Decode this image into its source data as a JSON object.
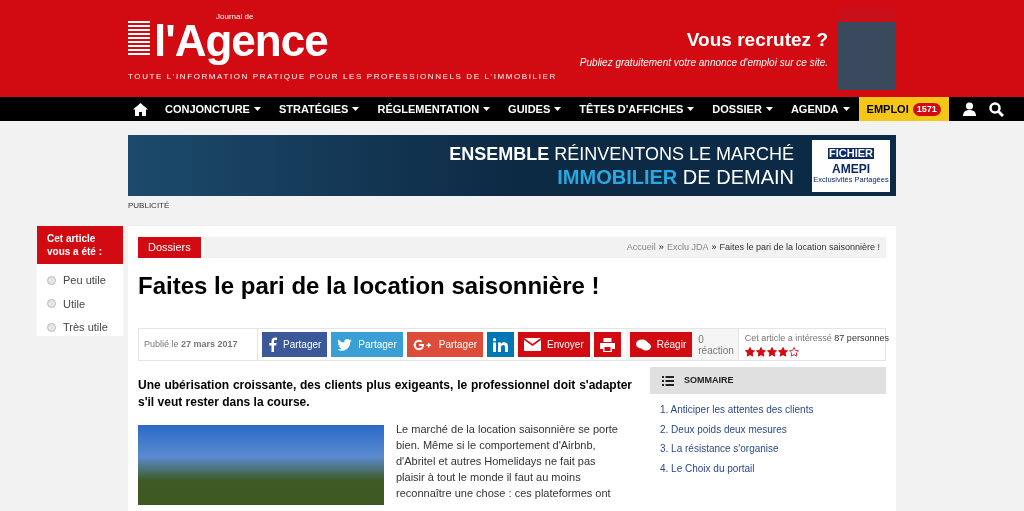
{
  "header": {
    "logo": {
      "small": "Journal de",
      "name": "l'Agence"
    },
    "tagline": "TOUTE L'INFORMATION PRATIQUE POUR LES PROFESSIONNELS DE L'IMMOBILIER",
    "promo": {
      "title": "Vous recrutez ?",
      "subtitle": "Publiez gratuitement votre annonce d'emploi sur ce site."
    }
  },
  "nav": {
    "items": [
      {
        "label": "CONJONCTURE"
      },
      {
        "label": "STRATÉGIES"
      },
      {
        "label": "RÉGLEMENTATION"
      },
      {
        "label": "GUIDES"
      },
      {
        "label": "TÊTES D'AFFICHES"
      },
      {
        "label": "DOSSIER"
      },
      {
        "label": "AGENDA"
      }
    ],
    "emploi": {
      "label": "EMPLOI",
      "count": "1571"
    }
  },
  "banner": {
    "line_1_bold": "ENSEMBLE",
    "line_1": "RÉINVENTONS LE MARCHÉ",
    "line_2_accent": "IMMOBILIER",
    "line_2": "DE DEMAIN",
    "logo_top": "FICHIER",
    "logo_name": "AMEPI",
    "logo_sub": "Exclusivités Partagées"
  },
  "ad_label": "PUBLICITÉ",
  "rating_box": {
    "title": "Cet article vous a été :",
    "options": [
      {
        "label": "Peu utile",
        "selected": false
      },
      {
        "label": "Utile",
        "selected": false
      },
      {
        "label": "Très utile",
        "selected": false
      }
    ]
  },
  "article": {
    "category": "Dossiers",
    "breadcrumb_separator": "»",
    "breadcrumb": [
      {
        "label": "Accueil",
        "current": false
      },
      {
        "label": "Exclu JDA",
        "current": false
      },
      {
        "label": "Faites le pari de la location saisonnière !",
        "current": true
      }
    ],
    "title": "Faites le pari de la location saisonnière !",
    "published": "Publié le **27 mars 2017**",
    "share": [
      {
        "kind": "facebook",
        "label": "Partager"
      },
      {
        "kind": "twitter",
        "label": "Partager"
      },
      {
        "kind": "gplus",
        "label": "Partager"
      },
      {
        "kind": "linkedin"
      },
      {
        "kind": "email",
        "label": "Envoyer"
      },
      {
        "kind": "print"
      }
    ],
    "react": {
      "label": "Réagir",
      "count": "0",
      "unit": "réaction"
    },
    "interest": {
      "text": "Cet article a intéressé **87 personnes**",
      "stars": 4
    },
    "lead": "Une ubérisation croissante, des clients plus exigeants, le professionnel doit s'adapter s'il veut rester dans la course.",
    "body": "Le marché de la location saisonnière se porte bien. Même si le comportement d'Airbnb, d'Abritel et autres Homelidays ne fait pas plaisir à tout le monde il faut au moins reconnaître une chose : ces plateformes ont",
    "summary": {
      "title": "SOMMAIRE",
      "items": [
        "1. Anticiper les attentes des clients",
        "2. Deux poids deux mesures",
        "3. La résistance s'organise",
        "4. Le Choix du portail"
      ]
    }
  }
}
